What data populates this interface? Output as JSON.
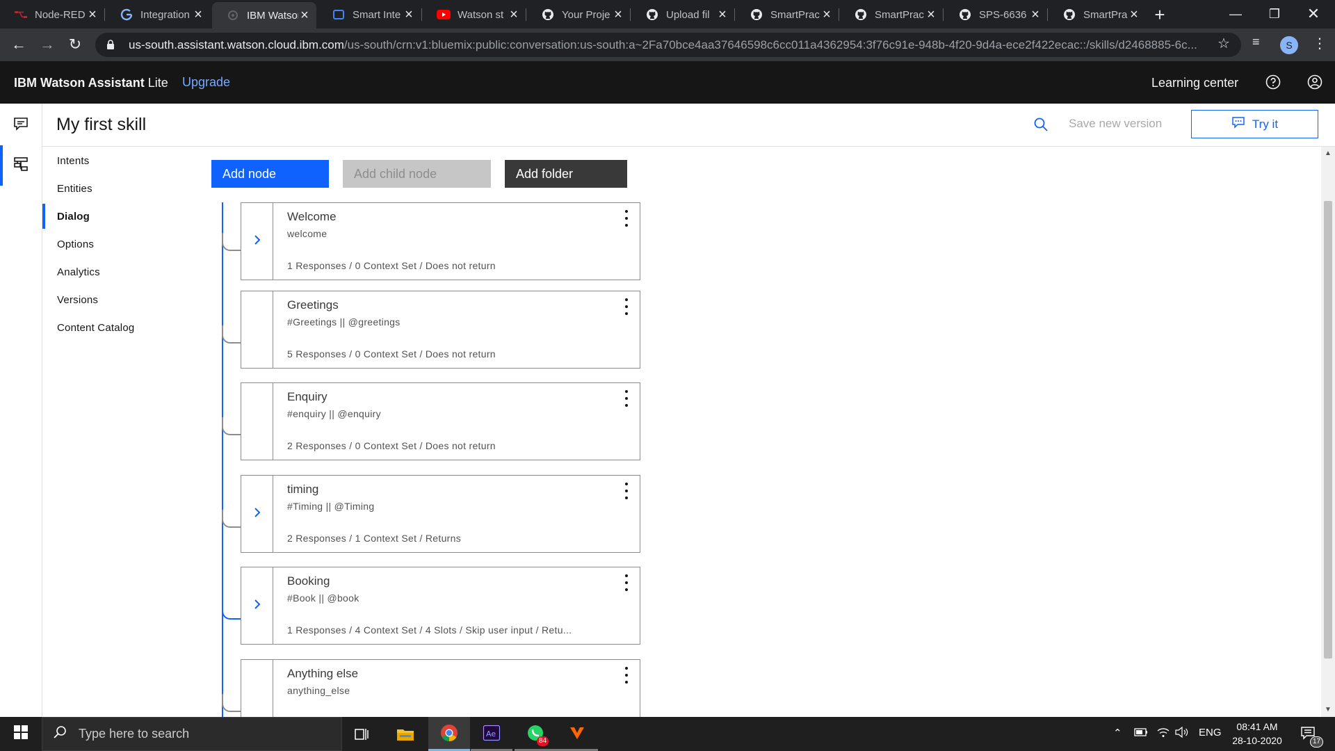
{
  "browser": {
    "tabs": [
      {
        "title": "Node-RED",
        "icon": "node-red-icon"
      },
      {
        "title": "Integration",
        "icon": "google-icon"
      },
      {
        "title": "IBM Watson",
        "icon": "watson-icon"
      },
      {
        "title": "Smart Inte",
        "icon": "page-icon"
      },
      {
        "title": "Watson st",
        "icon": "youtube-icon"
      },
      {
        "title": "Your Proje",
        "icon": "github-icon"
      },
      {
        "title": "Upload fil",
        "icon": "github-icon"
      },
      {
        "title": "SmartPrac",
        "icon": "github-icon"
      },
      {
        "title": "SmartPrac",
        "icon": "github-icon"
      },
      {
        "title": "SPS-6636",
        "icon": "github-icon"
      },
      {
        "title": "SmartPrac",
        "icon": "github-icon"
      }
    ],
    "url_host": "us-south.assistant.watson.cloud.ibm.com",
    "url_path": "/us-south/crn:v1:bluemix:public:conversation:us-south:a~2Fa70bce4aa37646598c6cc011a4362954:3f76c91e-948b-4f20-9d4a-ece2f422ecac::/skills/d2468885-6c...",
    "profile_initial": "S"
  },
  "header": {
    "brand_bold": "IBM Watson Assistant",
    "brand_plan": "Lite",
    "upgrade_label": "Upgrade",
    "learning_center_label": "Learning center"
  },
  "page": {
    "title": "My first skill",
    "save_version_label": "Save new version",
    "try_it_label": "Try it"
  },
  "sidenav": {
    "items": [
      {
        "label": "Intents",
        "active": false
      },
      {
        "label": "Entities",
        "active": false
      },
      {
        "label": "Dialog",
        "active": true
      },
      {
        "label": "Options",
        "active": false
      },
      {
        "label": "Analytics",
        "active": false
      },
      {
        "label": "Versions",
        "active": false
      },
      {
        "label": "Content Catalog",
        "active": false
      }
    ]
  },
  "toolbar": {
    "add_node_label": "Add node",
    "add_child_label": "Add child node",
    "add_folder_label": "Add folder"
  },
  "nodes": [
    {
      "title": "Welcome",
      "condition": "welcome",
      "summary": "1 Responses / 0 Context Set / Does not return",
      "has_children": true
    },
    {
      "title": "Greetings",
      "condition": "#Greetings || @greetings",
      "summary": "5 Responses / 0 Context Set / Does not return",
      "has_children": false
    },
    {
      "title": "Enquiry",
      "condition": "#enquiry || @enquiry",
      "summary": "2 Responses / 0 Context Set / Does not return",
      "has_children": false
    },
    {
      "title": "timing",
      "condition": "#Timing || @Timing",
      "summary": "2 Responses / 1 Context Set / Returns",
      "has_children": true
    },
    {
      "title": "Booking",
      "condition": "#Book || @book",
      "summary": "1 Responses / 4 Context Set / 4 Slots / Skip user input / Retu...",
      "has_children": true
    },
    {
      "title": "Anything else",
      "condition": "anything_else",
      "summary": "",
      "has_children": false
    }
  ],
  "taskbar": {
    "search_placeholder": "Type here to search",
    "whatsapp_badge": "84",
    "language": "ENG",
    "time": "08:41 AM",
    "date": "28-10-2020",
    "notification_count": "17"
  },
  "colors": {
    "accent": "#0f62fe",
    "header_bg": "#161616",
    "browser_bg": "#202124"
  }
}
